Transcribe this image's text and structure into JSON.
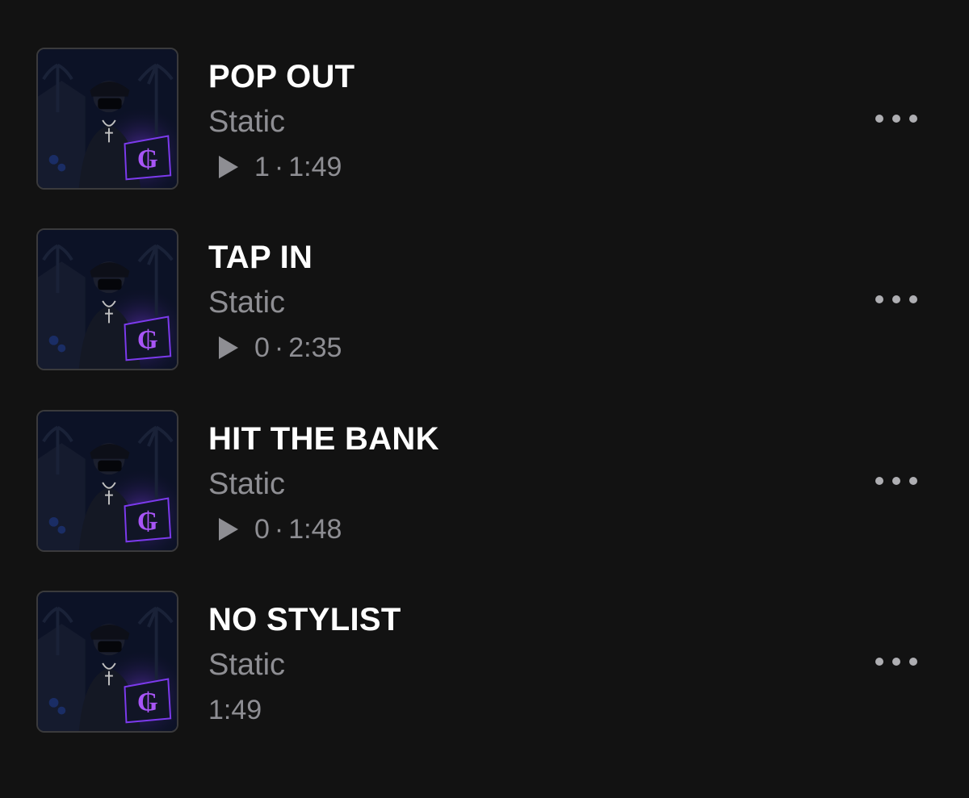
{
  "tracks": [
    {
      "title": "POP OUT",
      "artist": "Static",
      "plays": "1",
      "separator": "·",
      "duration": "1:49",
      "show_plays": true
    },
    {
      "title": "TAP IN",
      "artist": "Static",
      "plays": "0",
      "separator": "·",
      "duration": "2:35",
      "show_plays": true
    },
    {
      "title": "HIT THE BANK",
      "artist": "Static",
      "plays": "0",
      "separator": "·",
      "duration": "1:48",
      "show_plays": true
    },
    {
      "title": "NO STYLIST",
      "artist": "Static",
      "plays": "",
      "separator": "",
      "duration": "1:49",
      "show_plays": false
    }
  ],
  "icons": {
    "play": "play-icon",
    "more": "more-options-icon"
  },
  "colors": {
    "background": "#121212",
    "title": "#ffffff",
    "secondary": "#8e8e93",
    "artwork_accent": "#a855f7"
  }
}
